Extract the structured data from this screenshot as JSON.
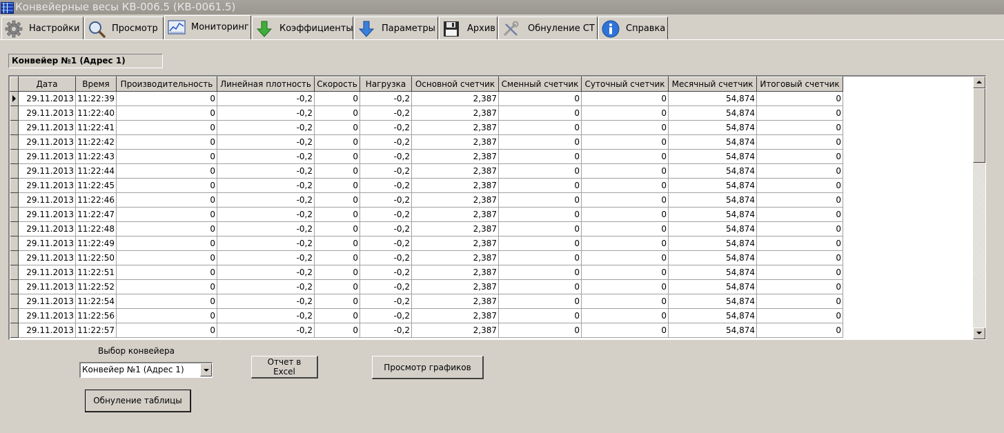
{
  "window": {
    "title": "Конвейерные весы КВ-006.5 (КВ-0061.5)"
  },
  "tabs": [
    {
      "label": "Настройки",
      "icon": "gear-icon",
      "active": false
    },
    {
      "label": "Просмотр",
      "icon": "magnifier-icon",
      "active": false
    },
    {
      "label": "Мониторинг",
      "icon": "monitor-chart-icon",
      "active": true
    },
    {
      "label": "Коэффициенты",
      "icon": "green-down-arrow-icon",
      "active": false
    },
    {
      "label": "Параметры",
      "icon": "blue-down-arrow-icon",
      "active": false
    },
    {
      "label": "Архив",
      "icon": "floppy-disk-icon",
      "active": false
    },
    {
      "label": "Обнуление СТ",
      "icon": "tools-icon",
      "active": false
    },
    {
      "label": "Справка",
      "icon": "info-icon",
      "active": false
    }
  ],
  "conveyor_label": "Конвейер №1 (Адрес 1)",
  "grid": {
    "columns": [
      "Дата",
      "Время",
      "Производительность",
      "Линейная плотность",
      "Скорость",
      "Нагрузка",
      "Основной счетчик",
      "Сменный счетчик",
      "Суточный счетчик",
      "Месячный счетчик",
      "Итоговый счетчик"
    ],
    "rows": [
      [
        "29.11.2013",
        "11:22:39",
        "0",
        "-0,2",
        "0",
        "-0,2",
        "2,387",
        "0",
        "0",
        "54,874",
        "0"
      ],
      [
        "29.11.2013",
        "11:22:40",
        "0",
        "-0,2",
        "0",
        "-0,2",
        "2,387",
        "0",
        "0",
        "54,874",
        "0"
      ],
      [
        "29.11.2013",
        "11:22:41",
        "0",
        "-0,2",
        "0",
        "-0,2",
        "2,387",
        "0",
        "0",
        "54,874",
        "0"
      ],
      [
        "29.11.2013",
        "11:22:42",
        "0",
        "-0,2",
        "0",
        "-0,2",
        "2,387",
        "0",
        "0",
        "54,874",
        "0"
      ],
      [
        "29.11.2013",
        "11:22:43",
        "0",
        "-0,2",
        "0",
        "-0,2",
        "2,387",
        "0",
        "0",
        "54,874",
        "0"
      ],
      [
        "29.11.2013",
        "11:22:44",
        "0",
        "-0,2",
        "0",
        "-0,2",
        "2,387",
        "0",
        "0",
        "54,874",
        "0"
      ],
      [
        "29.11.2013",
        "11:22:45",
        "0",
        "-0,2",
        "0",
        "-0,2",
        "2,387",
        "0",
        "0",
        "54,874",
        "0"
      ],
      [
        "29.11.2013",
        "11:22:46",
        "0",
        "-0,2",
        "0",
        "-0,2",
        "2,387",
        "0",
        "0",
        "54,874",
        "0"
      ],
      [
        "29.11.2013",
        "11:22:47",
        "0",
        "-0,2",
        "0",
        "-0,2",
        "2,387",
        "0",
        "0",
        "54,874",
        "0"
      ],
      [
        "29.11.2013",
        "11:22:48",
        "0",
        "-0,2",
        "0",
        "-0,2",
        "2,387",
        "0",
        "0",
        "54,874",
        "0"
      ],
      [
        "29.11.2013",
        "11:22:49",
        "0",
        "-0,2",
        "0",
        "-0,2",
        "2,387",
        "0",
        "0",
        "54,874",
        "0"
      ],
      [
        "29.11.2013",
        "11:22:50",
        "0",
        "-0,2",
        "0",
        "-0,2",
        "2,387",
        "0",
        "0",
        "54,874",
        "0"
      ],
      [
        "29.11.2013",
        "11:22:51",
        "0",
        "-0,2",
        "0",
        "-0,2",
        "2,387",
        "0",
        "0",
        "54,874",
        "0"
      ],
      [
        "29.11.2013",
        "11:22:52",
        "0",
        "-0,2",
        "0",
        "-0,2",
        "2,387",
        "0",
        "0",
        "54,874",
        "0"
      ],
      [
        "29.11.2013",
        "11:22:54",
        "0",
        "-0,2",
        "0",
        "-0,2",
        "2,387",
        "0",
        "0",
        "54,874",
        "0"
      ],
      [
        "29.11.2013",
        "11:22:56",
        "0",
        "-0,2",
        "0",
        "-0,2",
        "2,387",
        "0",
        "0",
        "54,874",
        "0"
      ],
      [
        "29.11.2013",
        "11:22:57",
        "0",
        "-0,2",
        "0",
        "-0,2",
        "2,387",
        "0",
        "0",
        "54,874",
        "0"
      ]
    ]
  },
  "conveyor_select": {
    "label": "Выбор конвейера",
    "value": "Конвейер №1 (Адрес 1)"
  },
  "buttons": {
    "excel": "Отчет в Excel",
    "charts": "Просмотр графиков",
    "reset_table": "Обнуление таблицы"
  }
}
